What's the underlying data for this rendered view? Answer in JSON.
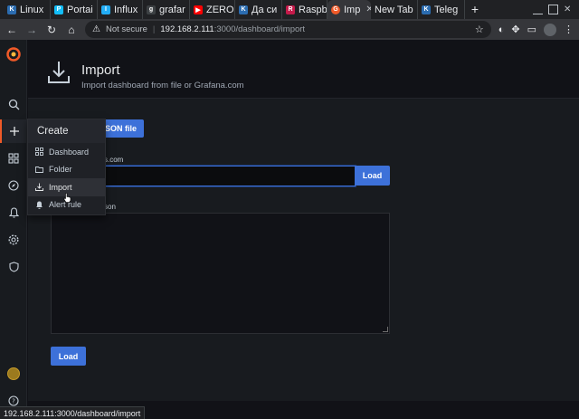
{
  "browser": {
    "tabs": [
      {
        "label": "Linux",
        "fav_color": "#2b6cb0",
        "fav_glyph": "K",
        "active": false
      },
      {
        "label": "Portai",
        "fav_color": "#13bef9",
        "fav_glyph": "P",
        "active": false
      },
      {
        "label": "Influx",
        "fav_color": "#22adf6",
        "fav_glyph": "I",
        "active": false
      },
      {
        "label": "grafar",
        "fav_color": "#3c4043",
        "fav_glyph": "g",
        "active": false
      },
      {
        "label": "ZERO",
        "fav_color": "#ff0000",
        "fav_glyph": "▶",
        "active": false
      },
      {
        "label": "Да си",
        "fav_color": "#2b6cb0",
        "fav_glyph": "K",
        "active": false
      },
      {
        "label": "Raspb",
        "fav_color": "#c51a4a",
        "fav_glyph": "R",
        "active": false
      },
      {
        "label": "Imp",
        "fav_color": "#f05a28",
        "fav_glyph": "G",
        "active": true
      },
      {
        "label": "New Tab",
        "fav_color": "",
        "fav_glyph": "",
        "active": false
      },
      {
        "label": "Teleg",
        "fav_color": "#2b6cb0",
        "fav_glyph": "K",
        "active": false
      }
    ],
    "new_tab_glyph": "+",
    "address": {
      "security": "Not secure",
      "host": "192.168.2.111",
      "path": ":3000/dashboard/import"
    },
    "status_url": "192.168.2.111:3000/dashboard/import"
  },
  "page": {
    "title": "Import",
    "subtitle": "Import dashboard from file or Grafana.com",
    "upload_button": "SON file",
    "grafana_label": "s.com",
    "load_button_1": "Load",
    "json_label": "son",
    "load_button_2": "Load"
  },
  "create_menu": {
    "title": "Create",
    "items": [
      {
        "label": "Dashboard",
        "icon": "apps-icon"
      },
      {
        "label": "Folder",
        "icon": "folder-icon"
      },
      {
        "label": "Import",
        "icon": "import-icon"
      },
      {
        "label": "Alert rule",
        "icon": "bell-icon"
      }
    ]
  },
  "colors": {
    "accent": "#3d71d9",
    "grafana_orange": "#f05a28"
  }
}
